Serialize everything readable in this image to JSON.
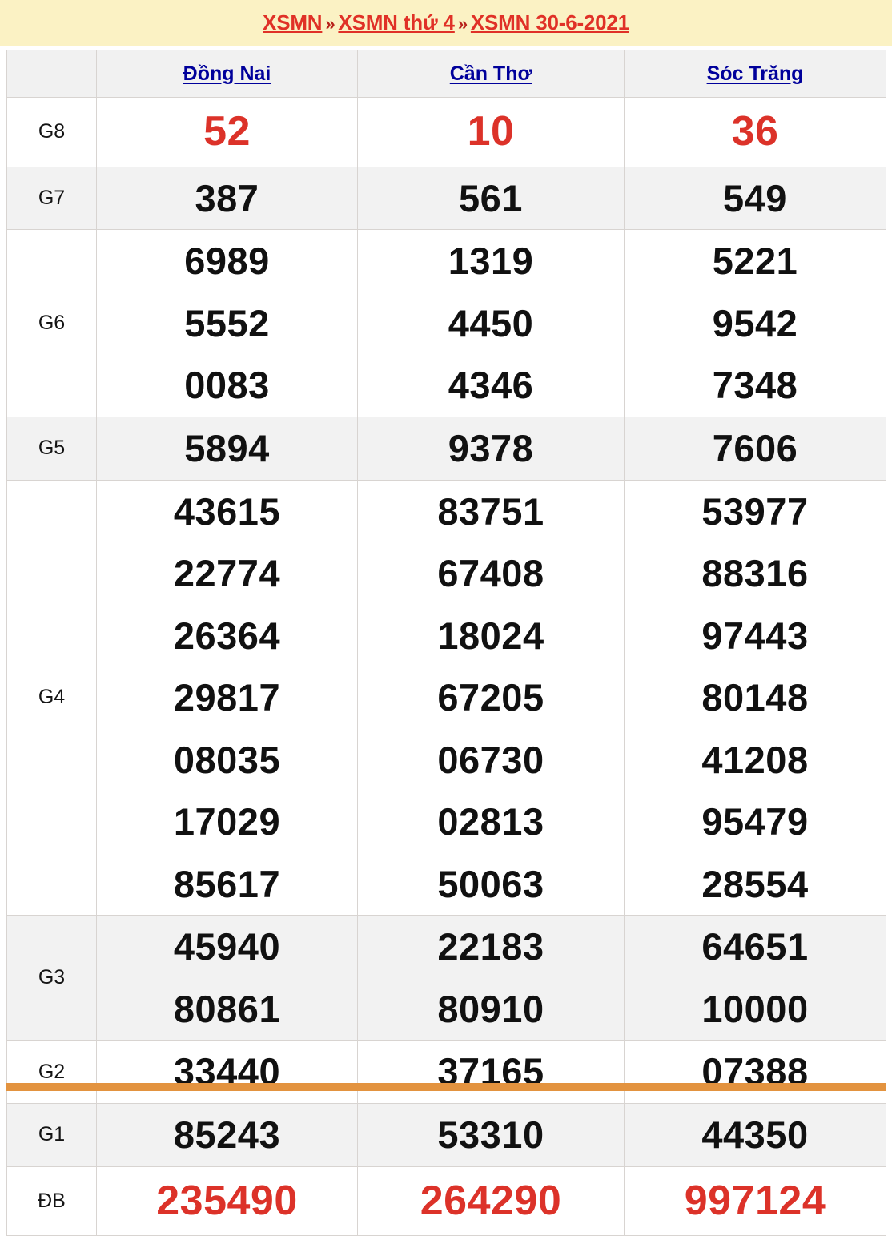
{
  "breadcrumb": {
    "items": [
      {
        "label": "XSMN"
      },
      {
        "label": "XSMN thứ 4"
      },
      {
        "label": "XSMN 30-6-2021"
      }
    ],
    "separator": "»",
    "link_color": "#e03127"
  },
  "table": {
    "corner_label": "",
    "columns": [
      {
        "label": "Đồng Nai",
        "name": "dong-nai"
      },
      {
        "label": "Cần Thơ",
        "name": "can-tho"
      },
      {
        "label": "Sóc Trăng",
        "name": "soc-trang"
      }
    ],
    "header_link_color": "#00009b",
    "highlight_color": "#dc3229",
    "rows": [
      {
        "prize": "G8",
        "emphasis": "red",
        "size": "xbig",
        "cells": [
          [
            "52"
          ],
          [
            "10"
          ],
          [
            "36"
          ]
        ]
      },
      {
        "prize": "G7",
        "emphasis": "normal",
        "size": "big",
        "cells": [
          [
            "387"
          ],
          [
            "561"
          ],
          [
            "549"
          ]
        ]
      },
      {
        "prize": "G6",
        "emphasis": "normal",
        "size": "big",
        "cells": [
          [
            "6989",
            "5552",
            "0083"
          ],
          [
            "1319",
            "4450",
            "4346"
          ],
          [
            "5221",
            "9542",
            "7348"
          ]
        ]
      },
      {
        "prize": "G5",
        "emphasis": "normal",
        "size": "big",
        "cells": [
          [
            "5894"
          ],
          [
            "9378"
          ],
          [
            "7606"
          ]
        ]
      },
      {
        "prize": "G4",
        "emphasis": "normal",
        "size": "big",
        "cells": [
          [
            "43615",
            "22774",
            "26364",
            "29817",
            "08035",
            "17029",
            "85617"
          ],
          [
            "83751",
            "67408",
            "18024",
            "67205",
            "06730",
            "02813",
            "50063"
          ],
          [
            "53977",
            "88316",
            "97443",
            "80148",
            "41208",
            "95479",
            "28554"
          ]
        ]
      },
      {
        "prize": "G3",
        "emphasis": "normal",
        "size": "big",
        "cells": [
          [
            "45940",
            "80861"
          ],
          [
            "22183",
            "80910"
          ],
          [
            "64651",
            "10000"
          ]
        ]
      },
      {
        "prize": "G2",
        "emphasis": "normal",
        "size": "big",
        "cells": [
          [
            "33440"
          ],
          [
            "37165"
          ],
          [
            "07388"
          ]
        ]
      },
      {
        "prize": "G1",
        "emphasis": "normal",
        "size": "big",
        "cells": [
          [
            "85243"
          ],
          [
            "53310"
          ],
          [
            "44350"
          ]
        ]
      },
      {
        "prize": "ĐB",
        "emphasis": "red",
        "size": "xbig",
        "cells": [
          [
            "235490"
          ],
          [
            "264290"
          ],
          [
            "997124"
          ]
        ]
      }
    ]
  },
  "footer": {
    "bar_color": "#e3933f"
  }
}
